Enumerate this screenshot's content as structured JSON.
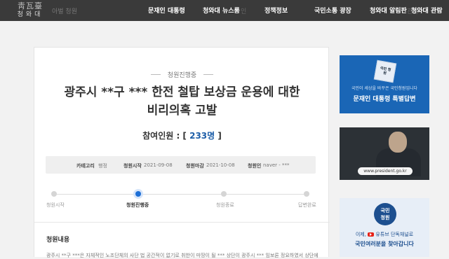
{
  "header": {
    "logo_mark": "靑瓦臺",
    "logo_name": "청와대",
    "ghost_left": "아벌 청원",
    "ghost_mid": "인",
    "ghost_right": "관련",
    "nav": [
      "문재인 대통령",
      "청와대 뉴스룸",
      "정책정보",
      "국민소통 광장",
      "청와대 알림판",
      "청와대 관람"
    ]
  },
  "petition": {
    "status_label": "청원진행중",
    "title_line1": "광주시 **구 *** 한전 철탑 보상금 운용에 대한",
    "title_line2": "비리의혹 고발",
    "count_label": "참여인원 : [",
    "count_value": "233명",
    "count_close": "]",
    "info": {
      "category_label": "카테고리",
      "category_value": "행정",
      "start_label": "청원시작",
      "start_value": "2021-09-08",
      "end_label": "청원마감",
      "end_value": "2021-10-08",
      "author_label": "청원인",
      "author_value": "naver - ***"
    },
    "progress": {
      "steps": [
        "청원시작",
        "청원진행중",
        "청원종료",
        "답변완료"
      ],
      "active_step": 1
    },
    "section_title": "청원내용",
    "body_preview": "광주시 **구 ***은 자체적인 노조단체의 사단 법 공간적이 없기로 취한이 마땅이 될 *** 상단이 광주시 *** 임보론 정요하였서 상단에 공금"
  },
  "sidebar": {
    "banner1": {
      "badge": "국민 청원",
      "subtitle": "국민이 세상을 바꾸은 국민청원입니다",
      "title": "문재인 대통령 특별답변"
    },
    "banner2": {
      "url": "www.president.go.kr"
    },
    "banner3": {
      "badge_line1": "국민",
      "badge_line2": "청원",
      "line1_pre": "이제,",
      "line1_mid": "유튜브 단독채널로",
      "line2": "국민여러분을 찾아갑니다"
    }
  },
  "colors": {
    "topbar": "#3a3a3a",
    "accent": "#1d5ea8",
    "active_dot": "#1d6fd6",
    "banner_blue": "#1a66b6"
  }
}
